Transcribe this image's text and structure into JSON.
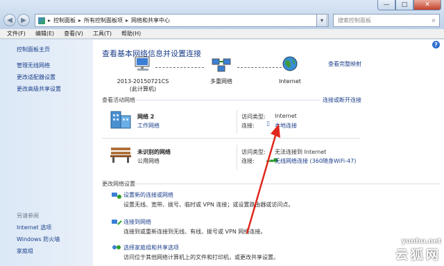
{
  "address": {
    "items": [
      "控制面板",
      "所有控制面板项",
      "网络和共享中心"
    ]
  },
  "search": {
    "placeholder": "搜索控制面板"
  },
  "window_buttons": {
    "min": "—",
    "max": "□",
    "close": "✕"
  },
  "menu": [
    "文件(F)",
    "编辑(E)",
    "查看(V)",
    "工具(T)",
    "帮助(H)"
  ],
  "left": {
    "home": "控制面板主页",
    "tasks": [
      "管理无线网络",
      "更改适配器设置",
      "更改高级共享设置"
    ],
    "see_also_label": "另请参阅",
    "see_also": [
      "Internet 选项",
      "Windows 防火墙",
      "家庭组"
    ]
  },
  "main": {
    "title": "查看基本网络信息并设置连接",
    "full_map": "查看完整映射",
    "nodes": [
      {
        "name": "2013-20150721CS",
        "sub": "(此计算机)",
        "icon": "computer-icon"
      },
      {
        "name": "多重网络",
        "sub": "",
        "icon": "network-icon"
      },
      {
        "name": "Internet",
        "sub": "",
        "icon": "globe-icon"
      }
    ],
    "active_label": "查看活动网络",
    "connect_link": "连接或断开连接",
    "networks": [
      {
        "name": "网络  2",
        "type": "工作网络",
        "access_label": "访问类型:",
        "access_value": "Internet",
        "conn_label": "连接:",
        "conn_value": "本地连接",
        "icon": "building-icon"
      },
      {
        "name": "未识别的网络",
        "type": "公用网络",
        "access_label": "访问类型:",
        "access_value": "无法连接到 Internet",
        "conn_label": "连接:",
        "conn_value": "无线网络连接 (360随身WiFi-47)",
        "icon": "bench-icon"
      }
    ],
    "settings_label": "更改网络设置",
    "tasks": [
      {
        "title": "设置新的连接或网络",
        "desc": "设置无线、宽带、拨号、临时或 VPN 连接；或设置路由器或访问点。"
      },
      {
        "title": "连接到网络",
        "desc": "连接到或重新连接到无线、有线、拨号或 VPN 网络连接。"
      },
      {
        "title": "选择家庭组和共享选项",
        "desc": "访问位于其他网络计算机上的文件和打印机，或更改共享设置。"
      }
    ]
  },
  "watermark": {
    "url": "yunhu.net",
    "text": "云狐网"
  },
  "colors": {
    "link": "#1b3f8b",
    "annotation_arrow": "#e0271c"
  }
}
